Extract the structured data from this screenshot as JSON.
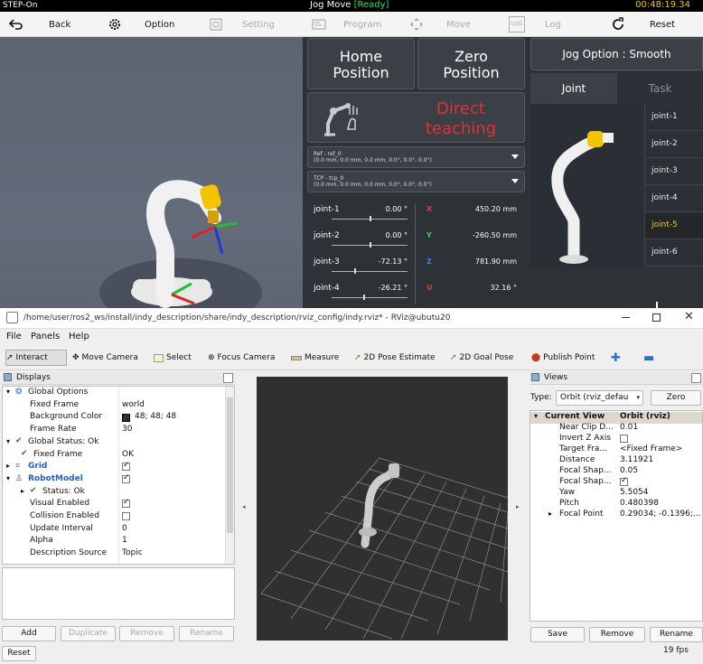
{
  "status": {
    "left": "STEP-On",
    "mode": "Jog Move",
    "state": "[Ready]",
    "time": "00:48:19.34"
  },
  "toolbar": {
    "back": "Back",
    "option": "Option",
    "setting": "Setting",
    "program": "Program",
    "move": "Move",
    "log": "Log",
    "reset": "Reset",
    "log_icon": "LOG"
  },
  "pendant": {
    "home": [
      "Home",
      "Position"
    ],
    "zero": [
      "Zero",
      "Position"
    ],
    "direct": [
      "Direct",
      "teaching"
    ],
    "ref": {
      "l1": "Ref - ref_0",
      "l2": "(0.0 mm, 0.0 mm, 0.0 mm, 0.0°, 0.0°, 0.0°)"
    },
    "tcp": {
      "l1": "TCP - tcp_0",
      "l2": "(0.0 mm, 0.0 mm, 0.0 mm, 0.0°, 0.0°, 0.0°)"
    },
    "joints": [
      {
        "name": "joint-1",
        "value": "0.00 °",
        "level": 0.5
      },
      {
        "name": "joint-2",
        "value": "0.00 °",
        "level": 0.5
      },
      {
        "name": "joint-3",
        "value": "-72.13 °",
        "level": 0.3
      },
      {
        "name": "joint-4",
        "value": "-26.21 °",
        "level": 0.42
      }
    ],
    "coords": [
      {
        "axis": "X",
        "value": "450.20 mm",
        "color": "#e0413a"
      },
      {
        "axis": "Y",
        "value": "-260.50 mm",
        "color": "#3bd15a"
      },
      {
        "axis": "Z",
        "value": "781.90 mm",
        "color": "#4a78e8"
      },
      {
        "axis": "U",
        "value": "32.16 °",
        "color": "#e0413a"
      }
    ],
    "jog_option": "Jog Option : Smooth",
    "tabs": {
      "joint": "Joint",
      "task": "Task"
    },
    "joint_list": [
      "joint-1",
      "joint-2",
      "joint-3",
      "joint-4",
      "joint-5",
      "joint-6"
    ],
    "selected_joint": "joint-5",
    "accent": "#f5c400",
    "danger": "#e53030"
  },
  "rviz": {
    "title": "/home/user/ros2_ws/install/indy_description/share/indy_description/rviz_config/indy.rviz* - RViz@ubutu20",
    "menu": [
      "File",
      "Panels",
      "Help"
    ],
    "tools": [
      "Interact",
      "Move Camera",
      "Select",
      "Focus Camera",
      "Measure",
      "2D Pose Estimate",
      "2D Goal Pose",
      "Publish Point"
    ],
    "displays_title": "Displays",
    "displays": [
      {
        "label": "Global Options",
        "value": ""
      },
      {
        "label": "Fixed Frame",
        "value": "world"
      },
      {
        "label": "Background Color",
        "value": "48; 48; 48"
      },
      {
        "label": "Frame Rate",
        "value": "30"
      },
      {
        "label": "Global Status: Ok",
        "value": ""
      },
      {
        "label": "Fixed Frame",
        "value": "OK"
      },
      {
        "label": "Grid",
        "value": ""
      },
      {
        "label": "RobotModel",
        "value": ""
      },
      {
        "label": "Status: Ok",
        "value": ""
      },
      {
        "label": "Visual Enabled",
        "value": ""
      },
      {
        "label": "Collision Enabled",
        "value": ""
      },
      {
        "label": "Update Interval",
        "value": "0"
      },
      {
        "label": "Alpha",
        "value": "1"
      },
      {
        "label": "Description Source",
        "value": "Topic"
      }
    ],
    "buttons": {
      "add": "Add",
      "duplicate": "Duplicate",
      "remove": "Remove",
      "rename": "Rename",
      "reset": "Reset"
    },
    "views_title": "Views",
    "type_label": "Type:",
    "type_value": "Orbit (rviz_defau",
    "zero": "Zero",
    "views": [
      {
        "label": "Current View",
        "value": "Orbit (rviz)"
      },
      {
        "label": "Near Clip D...",
        "value": "0.01"
      },
      {
        "label": "Invert Z Axis",
        "value": ""
      },
      {
        "label": "Target Fra...",
        "value": "<Fixed Frame>"
      },
      {
        "label": "Distance",
        "value": "3.11921"
      },
      {
        "label": "Focal Shap...",
        "value": "0.05"
      },
      {
        "label": "Focal Shap...",
        "value": ""
      },
      {
        "label": "Yaw",
        "value": "5.5054"
      },
      {
        "label": "Pitch",
        "value": "0.480398"
      },
      {
        "label": "Focal Point",
        "value": "0.29034; -0.1396;..."
      }
    ],
    "view_buttons": {
      "save": "Save",
      "remove": "Remove",
      "rename": "Rename"
    },
    "fps": "19 fps",
    "bg": "#303030"
  }
}
